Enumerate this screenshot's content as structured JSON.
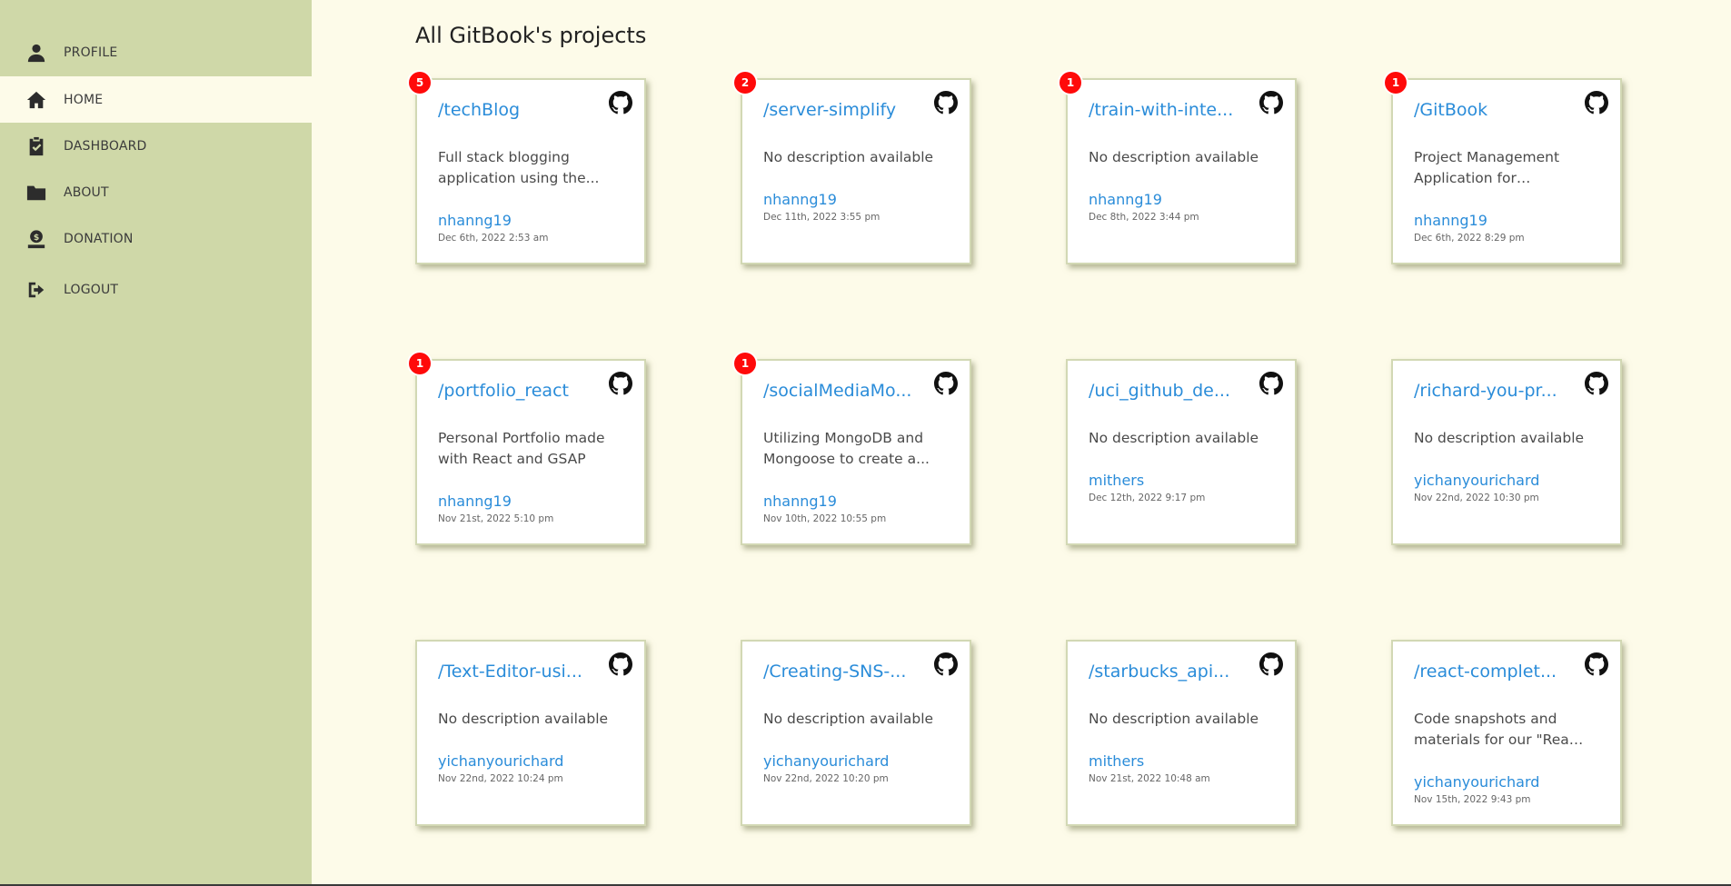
{
  "sidebar": {
    "items": [
      {
        "label": "PROFILE",
        "icon": "user-icon"
      },
      {
        "label": "HOME",
        "icon": "home-icon"
      },
      {
        "label": "DASHBOARD",
        "icon": "clipboard-check-icon"
      },
      {
        "label": "ABOUT",
        "icon": "folder-icon"
      },
      {
        "label": "DONATION",
        "icon": "donate-icon"
      },
      {
        "label": "LOGOUT",
        "icon": "sign-out-icon"
      }
    ],
    "active_item": "HOME"
  },
  "main": {
    "title": "All GitBook's projects"
  },
  "colors": {
    "sidebar_bg": "#cfd8a8",
    "page_bg": "#fdfbe9",
    "link": "#2a8cd9",
    "badge": "#ff0a0a"
  },
  "projects": [
    {
      "name": "/techBlog",
      "description": "Full stack blogging application using the...",
      "author": "nhanng19",
      "date": "Dec 6th, 2022 2:53 am",
      "badge": "5"
    },
    {
      "name": "/server-simplify",
      "description": "No description available",
      "author": "nhanng19",
      "date": "Dec 11th, 2022 3:55 pm",
      "badge": "2"
    },
    {
      "name": "/train-with-inte...",
      "description": "No description available",
      "author": "nhanng19",
      "date": "Dec 8th, 2022 3:44 pm",
      "badge": "1"
    },
    {
      "name": "/GitBook",
      "description": "Project Management Application for Developers",
      "author": "nhanng19",
      "date": "Dec 6th, 2022 8:29 pm",
      "badge": "1"
    },
    {
      "name": "/portfolio_react",
      "description": "Personal Portfolio made with React and GSAP",
      "author": "nhanng19",
      "date": "Nov 21st, 2022 5:10 pm",
      "badge": "1"
    },
    {
      "name": "/socialMediaMo...",
      "description": "Utilizing MongoDB and Mongoose to create a...",
      "author": "nhanng19",
      "date": "Nov 10th, 2022 10:55 pm",
      "badge": "1"
    },
    {
      "name": "/uci_github_de...",
      "description": "No description available",
      "author": "mithers",
      "date": "Dec 12th, 2022 9:17 pm",
      "badge": ""
    },
    {
      "name": "/richard-you-pr...",
      "description": "No description available",
      "author": "yichanyourichard",
      "date": "Nov 22nd, 2022 10:30 pm",
      "badge": ""
    },
    {
      "name": "/Text-Editor-usi...",
      "description": "No description available",
      "author": "yichanyourichard",
      "date": "Nov 22nd, 2022 10:24 pm",
      "badge": ""
    },
    {
      "name": "/Creating-SNS-...",
      "description": "No description available",
      "author": "yichanyourichard",
      "date": "Nov 22nd, 2022 10:20 pm",
      "badge": ""
    },
    {
      "name": "/starbucks_api...",
      "description": "No description available",
      "author": "mithers",
      "date": "Nov 21st, 2022 10:48 am",
      "badge": ""
    },
    {
      "name": "/react-complet...",
      "description": "Code snapshots and materials for our \"React -...",
      "author": "yichanyourichard",
      "date": "Nov 15th, 2022 9:43 pm",
      "badge": ""
    }
  ]
}
